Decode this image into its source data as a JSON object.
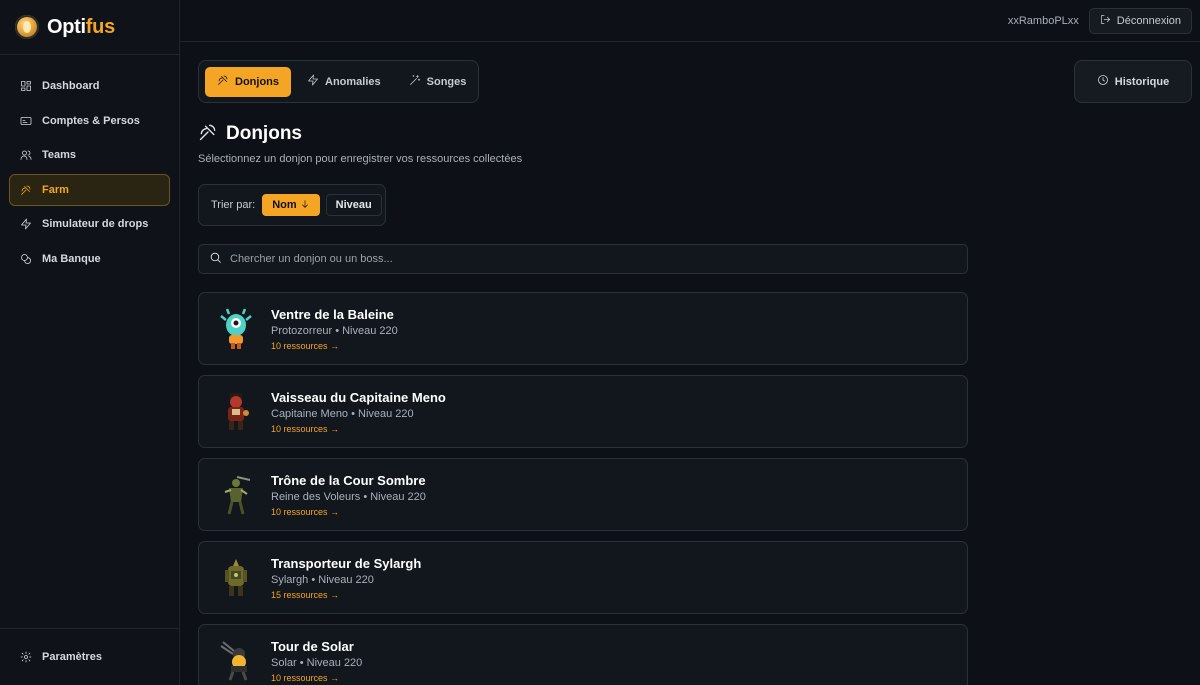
{
  "brand": {
    "name_part1": "Opti",
    "name_part2": "fus"
  },
  "sidebar": {
    "items": [
      {
        "label": "Dashboard",
        "icon": "dashboard-icon"
      },
      {
        "label": "Comptes & Persos",
        "icon": "id-card-icon"
      },
      {
        "label": "Teams",
        "icon": "users-icon"
      },
      {
        "label": "Farm",
        "icon": "pickaxe-icon",
        "active": true
      },
      {
        "label": "Simulateur de drops",
        "icon": "lightning-icon"
      },
      {
        "label": "Ma Banque",
        "icon": "coins-icon"
      }
    ],
    "footer_label": "Paramètres"
  },
  "topbar": {
    "username": "xxRamboPLxx",
    "logout_label": "Déconnexion"
  },
  "tabs": [
    {
      "label": "Donjons",
      "icon": "pickaxe-icon",
      "active": true
    },
    {
      "label": "Anomalies",
      "icon": "lightning-icon"
    },
    {
      "label": "Songes",
      "icon": "wand-icon"
    }
  ],
  "history_label": "Historique",
  "section": {
    "title": "Donjons",
    "subtitle": "Sélectionnez un donjon pour enregistrer vos ressources collectées"
  },
  "sort": {
    "label": "Trier par:",
    "name_label": "Nom",
    "level_label": "Niveau"
  },
  "search": {
    "placeholder": "Chercher un donjon ou un boss..."
  },
  "dungeons": [
    {
      "name": "Ventre de la Baleine",
      "meta": "Protozorreur • Niveau 220",
      "resources": "10 ressources →"
    },
    {
      "name": "Vaisseau du Capitaine Meno",
      "meta": "Capitaine Meno • Niveau 220",
      "resources": "10 ressources →"
    },
    {
      "name": "Trône de la Cour Sombre",
      "meta": "Reine des Voleurs • Niveau 220",
      "resources": "10 ressources →"
    },
    {
      "name": "Transporteur de Sylargh",
      "meta": "Sylargh • Niveau 220",
      "resources": "15 ressources →"
    },
    {
      "name": "Tour de Solar",
      "meta": "Solar • Niveau 220",
      "resources": "10 ressources →"
    }
  ],
  "colors": {
    "accent": "#f5a524",
    "background": "#0d1016",
    "panel": "#12161d",
    "border": "#2a313b"
  }
}
